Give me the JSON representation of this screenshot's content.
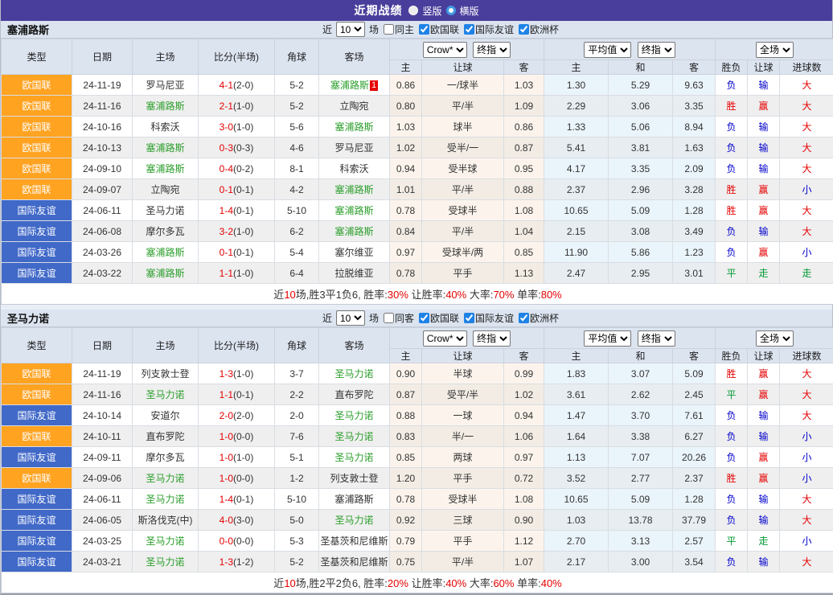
{
  "colors": {
    "title_purple": "#4a3e9c",
    "league_nations": "#ffa321",
    "league_friendly": "#4169c8",
    "team_highlight_green": "#2b9e2b",
    "win_red": "#e50000",
    "lose_blue": "#0000cc",
    "draw_green": "#009933"
  },
  "title_bar": {
    "title": "近期战绩",
    "radio_vertical": "竖版",
    "radio_horizontal": "横版"
  },
  "filter": {
    "near_label": "近",
    "near_value": "10",
    "games_label": "场",
    "leagues": [
      "欧国联",
      "国际友谊",
      "欧洲杯"
    ]
  },
  "header_labels": {
    "cols": [
      "类型",
      "日期",
      "主场",
      "比分(半场)",
      "角球",
      "客场"
    ],
    "select_crow": "Crow*",
    "select_final": "终指",
    "select_avg": "平均值",
    "select_fulltime": "全场",
    "sub_crow": [
      "主",
      "让球",
      "客"
    ],
    "sub_avg": [
      "主",
      "和",
      "客"
    ],
    "sub_result": [
      "胜负",
      "让球",
      "进球数"
    ]
  },
  "sections": [
    {
      "team": "塞浦路斯",
      "same_label": "同主",
      "rows": [
        {
          "comp": "欧国联",
          "date": "24-11-19",
          "home": "罗马尼亚",
          "home_hl": false,
          "ft": "4-1",
          "ht": "(2-0)",
          "corner": "5-2",
          "away": "塞浦路斯",
          "away_hl": true,
          "away_badge": "1",
          "crow": [
            "0.86",
            "一/球半",
            "1.03"
          ],
          "avg": [
            "1.30",
            "5.29",
            "9.63"
          ],
          "res": [
            "负",
            "输",
            "大"
          ]
        },
        {
          "comp": "欧国联",
          "date": "24-11-16",
          "home": "塞浦路斯",
          "home_hl": true,
          "ft": "2-1",
          "ht": "(1-0)",
          "corner": "5-2",
          "away": "立陶宛",
          "away_hl": false,
          "away_badge": "",
          "crow": [
            "0.80",
            "平/半",
            "1.09"
          ],
          "avg": [
            "2.29",
            "3.06",
            "3.35"
          ],
          "res": [
            "胜",
            "赢",
            "大"
          ]
        },
        {
          "comp": "欧国联",
          "date": "24-10-16",
          "home": "科索沃",
          "home_hl": false,
          "ft": "3-0",
          "ht": "(1-0)",
          "corner": "5-6",
          "away": "塞浦路斯",
          "away_hl": true,
          "away_badge": "",
          "crow": [
            "1.03",
            "球半",
            "0.86"
          ],
          "avg": [
            "1.33",
            "5.06",
            "8.94"
          ],
          "res": [
            "负",
            "输",
            "大"
          ]
        },
        {
          "comp": "欧国联",
          "date": "24-10-13",
          "home": "塞浦路斯",
          "home_hl": true,
          "ft": "0-3",
          "ht": "(0-3)",
          "corner": "4-6",
          "away": "罗马尼亚",
          "away_hl": false,
          "away_badge": "",
          "crow": [
            "1.02",
            "受半/一",
            "0.87"
          ],
          "avg": [
            "5.41",
            "3.81",
            "1.63"
          ],
          "res": [
            "负",
            "输",
            "大"
          ]
        },
        {
          "comp": "欧国联",
          "date": "24-09-10",
          "home": "塞浦路斯",
          "home_hl": true,
          "ft": "0-4",
          "ht": "(0-2)",
          "corner": "8-1",
          "away": "科索沃",
          "away_hl": false,
          "away_badge": "",
          "crow": [
            "0.94",
            "受半球",
            "0.95"
          ],
          "avg": [
            "4.17",
            "3.35",
            "2.09"
          ],
          "res": [
            "负",
            "输",
            "大"
          ]
        },
        {
          "comp": "欧国联",
          "date": "24-09-07",
          "home": "立陶宛",
          "home_hl": false,
          "ft": "0-1",
          "ht": "(0-1)",
          "corner": "4-2",
          "away": "塞浦路斯",
          "away_hl": true,
          "away_badge": "",
          "crow": [
            "1.01",
            "平/半",
            "0.88"
          ],
          "avg": [
            "2.37",
            "2.96",
            "3.28"
          ],
          "res": [
            "胜",
            "赢",
            "小"
          ]
        },
        {
          "comp": "国际友谊",
          "date": "24-06-11",
          "home": "圣马力诺",
          "home_hl": false,
          "ft": "1-4",
          "ht": "(0-1)",
          "corner": "5-10",
          "away": "塞浦路斯",
          "away_hl": true,
          "away_badge": "",
          "crow": [
            "0.78",
            "受球半",
            "1.08"
          ],
          "avg": [
            "10.65",
            "5.09",
            "1.28"
          ],
          "res": [
            "胜",
            "赢",
            "大"
          ]
        },
        {
          "comp": "国际友谊",
          "date": "24-06-08",
          "home": "摩尔多瓦",
          "home_hl": false,
          "ft": "3-2",
          "ht": "(1-0)",
          "corner": "6-2",
          "away": "塞浦路斯",
          "away_hl": true,
          "away_badge": "",
          "crow": [
            "0.84",
            "平/半",
            "1.04"
          ],
          "avg": [
            "2.15",
            "3.08",
            "3.49"
          ],
          "res": [
            "负",
            "输",
            "大"
          ]
        },
        {
          "comp": "国际友谊",
          "date": "24-03-26",
          "home": "塞浦路斯",
          "home_hl": true,
          "ft": "0-1",
          "ht": "(0-1)",
          "corner": "5-4",
          "away": "塞尔维亚",
          "away_hl": false,
          "away_badge": "",
          "crow": [
            "0.97",
            "受球半/两",
            "0.85"
          ],
          "avg": [
            "11.90",
            "5.86",
            "1.23"
          ],
          "res": [
            "负",
            "赢",
            "小"
          ]
        },
        {
          "comp": "国际友谊",
          "date": "24-03-22",
          "home": "塞浦路斯",
          "home_hl": true,
          "ft": "1-1",
          "ht": "(1-0)",
          "corner": "6-4",
          "away": "拉脱维亚",
          "away_hl": false,
          "away_badge": "",
          "crow": [
            "0.78",
            "平手",
            "1.13"
          ],
          "avg": [
            "2.47",
            "2.95",
            "3.01"
          ],
          "res": [
            "平",
            "走",
            "走"
          ]
        }
      ],
      "summary_segments": [
        [
          "近",
          "k"
        ],
        [
          "10",
          "r"
        ],
        [
          "场,胜3平1负6, 胜率:",
          "k"
        ],
        [
          "30%",
          "r"
        ],
        [
          " 让胜率:",
          "k"
        ],
        [
          "40%",
          "r"
        ],
        [
          " 大率:",
          "k"
        ],
        [
          "70%",
          "r"
        ],
        [
          " 单率:",
          "k"
        ],
        [
          "80%",
          "r"
        ]
      ]
    },
    {
      "team": "圣马力诺",
      "same_label": "同客",
      "rows": [
        {
          "comp": "欧国联",
          "date": "24-11-19",
          "home": "列支敦士登",
          "home_hl": false,
          "ft": "1-3",
          "ht": "(1-0)",
          "corner": "3-7",
          "away": "圣马力诺",
          "away_hl": true,
          "away_badge": "",
          "crow": [
            "0.90",
            "半球",
            "0.99"
          ],
          "avg": [
            "1.83",
            "3.07",
            "5.09"
          ],
          "res": [
            "胜",
            "赢",
            "大"
          ]
        },
        {
          "comp": "欧国联",
          "date": "24-11-16",
          "home": "圣马力诺",
          "home_hl": true,
          "ft": "1-1",
          "ht": "(0-1)",
          "corner": "2-2",
          "away": "直布罗陀",
          "away_hl": false,
          "away_badge": "",
          "crow": [
            "0.87",
            "受平/半",
            "1.02"
          ],
          "avg": [
            "3.61",
            "2.62",
            "2.45"
          ],
          "res": [
            "平",
            "赢",
            "大"
          ]
        },
        {
          "comp": "国际友谊",
          "date": "24-10-14",
          "home": "安道尔",
          "home_hl": false,
          "ft": "2-0",
          "ht": "(2-0)",
          "corner": "2-0",
          "away": "圣马力诺",
          "away_hl": true,
          "away_badge": "",
          "crow": [
            "0.88",
            "一球",
            "0.94"
          ],
          "avg": [
            "1.47",
            "3.70",
            "7.61"
          ],
          "res": [
            "负",
            "输",
            "大"
          ]
        },
        {
          "comp": "欧国联",
          "date": "24-10-11",
          "home": "直布罗陀",
          "home_hl": false,
          "ft": "1-0",
          "ht": "(0-0)",
          "corner": "7-6",
          "away": "圣马力诺",
          "away_hl": true,
          "away_badge": "",
          "crow": [
            "0.83",
            "半/一",
            "1.06"
          ],
          "avg": [
            "1.64",
            "3.38",
            "6.27"
          ],
          "res": [
            "负",
            "输",
            "小"
          ]
        },
        {
          "comp": "国际友谊",
          "date": "24-09-11",
          "home": "摩尔多瓦",
          "home_hl": false,
          "ft": "1-0",
          "ht": "(1-0)",
          "corner": "5-1",
          "away": "圣马力诺",
          "away_hl": true,
          "away_badge": "",
          "crow": [
            "0.85",
            "两球",
            "0.97"
          ],
          "avg": [
            "1.13",
            "7.07",
            "20.26"
          ],
          "res": [
            "负",
            "赢",
            "小"
          ]
        },
        {
          "comp": "欧国联",
          "date": "24-09-06",
          "home": "圣马力诺",
          "home_hl": true,
          "ft": "1-0",
          "ht": "(0-0)",
          "corner": "1-2",
          "away": "列支敦士登",
          "away_hl": false,
          "away_badge": "",
          "crow": [
            "1.20",
            "平手",
            "0.72"
          ],
          "avg": [
            "3.52",
            "2.77",
            "2.37"
          ],
          "res": [
            "胜",
            "赢",
            "小"
          ]
        },
        {
          "comp": "国际友谊",
          "date": "24-06-11",
          "home": "圣马力诺",
          "home_hl": true,
          "ft": "1-4",
          "ht": "(0-1)",
          "corner": "5-10",
          "away": "塞浦路斯",
          "away_hl": false,
          "away_badge": "",
          "crow": [
            "0.78",
            "受球半",
            "1.08"
          ],
          "avg": [
            "10.65",
            "5.09",
            "1.28"
          ],
          "res": [
            "负",
            "输",
            "大"
          ]
        },
        {
          "comp": "国际友谊",
          "date": "24-06-05",
          "home": "斯洛伐克(中)",
          "home_hl": false,
          "ft": "4-0",
          "ht": "(3-0)",
          "corner": "5-0",
          "away": "圣马力诺",
          "away_hl": true,
          "away_badge": "",
          "crow": [
            "0.92",
            "三球",
            "0.90"
          ],
          "avg": [
            "1.03",
            "13.78",
            "37.79"
          ],
          "res": [
            "负",
            "输",
            "大"
          ]
        },
        {
          "comp": "国际友谊",
          "date": "24-03-25",
          "home": "圣马力诺",
          "home_hl": true,
          "ft": "0-0",
          "ht": "(0-0)",
          "corner": "5-3",
          "away": "圣基茨和尼维斯",
          "away_hl": false,
          "away_badge": "",
          "crow": [
            "0.79",
            "平手",
            "1.12"
          ],
          "avg": [
            "2.70",
            "3.13",
            "2.57"
          ],
          "res": [
            "平",
            "走",
            "小"
          ]
        },
        {
          "comp": "国际友谊",
          "date": "24-03-21",
          "home": "圣马力诺",
          "home_hl": true,
          "ft": "1-3",
          "ht": "(1-2)",
          "corner": "5-2",
          "away": "圣基茨和尼维斯",
          "away_hl": false,
          "away_badge": "",
          "crow": [
            "0.75",
            "平/半",
            "1.07"
          ],
          "avg": [
            "2.17",
            "3.00",
            "3.54"
          ],
          "res": [
            "负",
            "输",
            "大"
          ]
        }
      ],
      "summary_segments": [
        [
          "近",
          "k"
        ],
        [
          "10",
          "r"
        ],
        [
          "场,胜2平2负6, 胜率:",
          "k"
        ],
        [
          "20%",
          "r"
        ],
        [
          " 让胜率:",
          "k"
        ],
        [
          "40%",
          "r"
        ],
        [
          " 大率:",
          "k"
        ],
        [
          "60%",
          "r"
        ],
        [
          " 单率:",
          "k"
        ],
        [
          "40%",
          "r"
        ]
      ]
    }
  ]
}
